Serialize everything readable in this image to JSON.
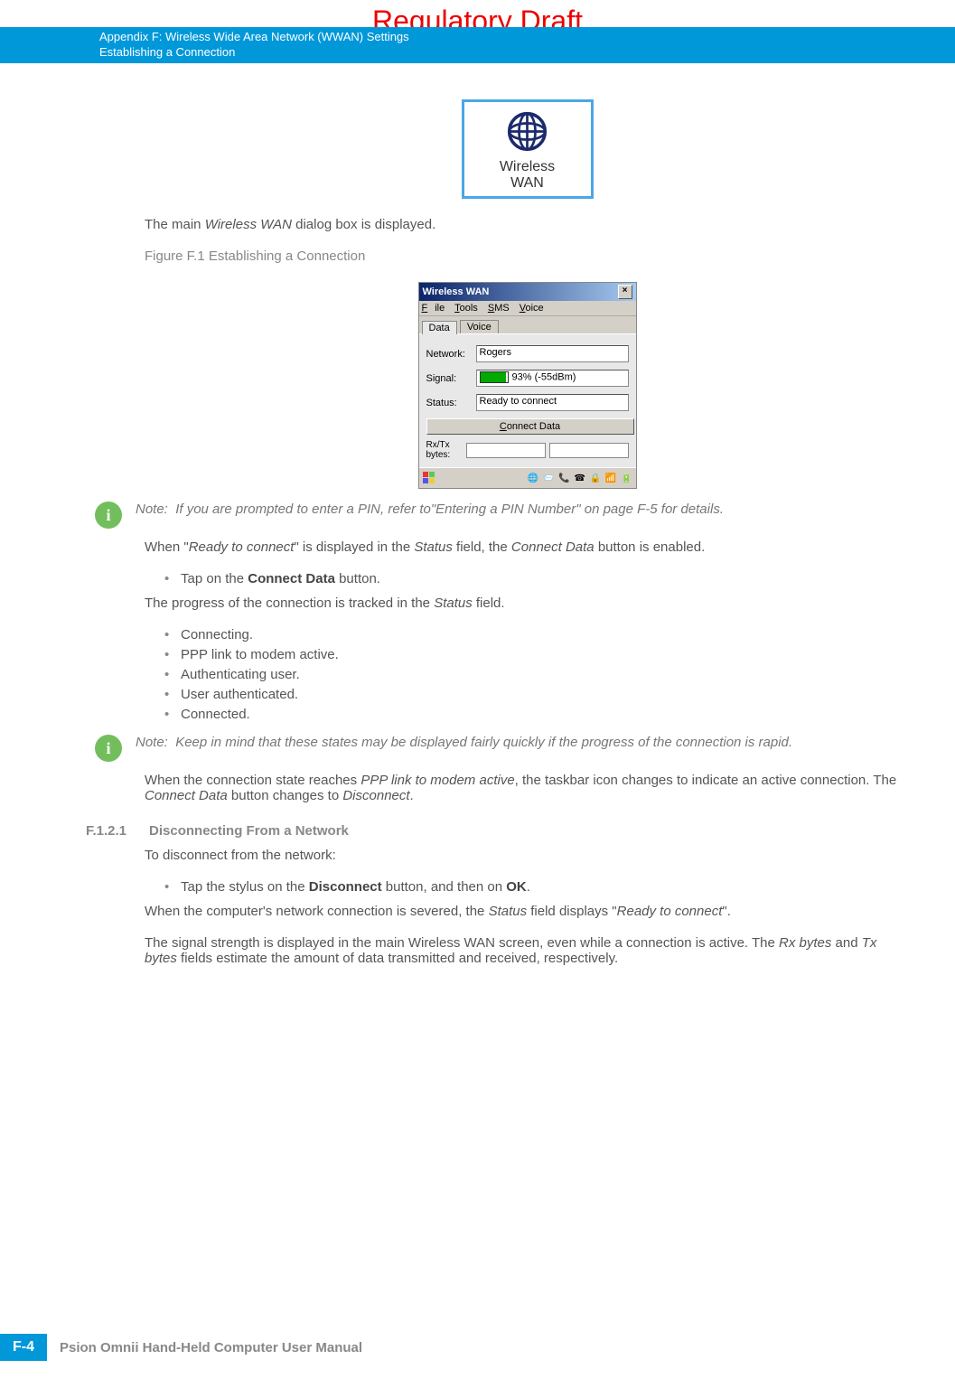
{
  "watermark": "Regulatory Draft",
  "header": {
    "line1": "Appendix F: Wireless Wide Area Network (WWAN) Settings",
    "line2": "Establishing a Connection"
  },
  "wwan_icon_label_line1": "Wireless",
  "wwan_icon_label_line2": "WAN",
  "para1_a": "The main ",
  "para1_em": "Wireless WAN",
  "para1_b": " dialog box is displayed.",
  "fig_caption": "Figure F.1      Establishing a Connection",
  "dialog": {
    "title": "Wireless WAN",
    "menu": {
      "file": "File",
      "tools": "Tools",
      "sms": "SMS",
      "voice": "Voice"
    },
    "tabs": {
      "data": "Data",
      "voice": "Voice"
    },
    "labels": {
      "network": "Network:",
      "signal": "Signal:",
      "status": "Status:",
      "rxtx": "Rx/Tx bytes:"
    },
    "values": {
      "network": "Rogers",
      "signal": "93% (-55dBm)",
      "status": "Ready to connect"
    },
    "connect_btn": "Connect Data"
  },
  "note1_prefix": "Note:",
  "note1_text": "If you are prompted to enter a PIN, refer to\"Entering a PIN Number\" on page F-5 for details.",
  "para2_a": "When \"",
  "para2_em1": "Ready to connect",
  "para2_b": "\" is displayed in the ",
  "para2_em2": "Status",
  "para2_c": " field, the ",
  "para2_em3": "Connect Data",
  "para2_d": " button is enabled.",
  "bullet_tap_a": "Tap on the ",
  "bullet_tap_b": "Connect Data",
  "bullet_tap_c": " button.",
  "para3_a": "The progress of the connection is tracked in the ",
  "para3_em": "Status",
  "para3_b": " field.",
  "status_list": [
    "Connecting.",
    "PPP link to modem active.",
    "Authenticating user.",
    "User authenticated.",
    "Connected."
  ],
  "note2_prefix": "Note:",
  "note2_text": "Keep in mind that these states may be displayed fairly quickly if the progress of the connection is rapid.",
  "para4_a": "When the connection state reaches ",
  "para4_em1": "PPP link to modem active",
  "para4_b": ", the taskbar icon changes to indicate an active connection. The ",
  "para4_em2": "Connect Data",
  "para4_c": " button changes to ",
  "para4_em3": "Disconnect",
  "para4_d": ".",
  "section_num": "F.1.2.1",
  "section_title": "Disconnecting From a Network",
  "para5": "To disconnect from the network:",
  "bullet_disc_a": "Tap the stylus on the ",
  "bullet_disc_b": "Disconnect",
  "bullet_disc_c": " button, and then on ",
  "bullet_disc_d": "OK",
  "bullet_disc_e": ".",
  "para6_a": "When the computer's network connection is severed, the ",
  "para6_em1": "Status",
  "para6_b": " field displays \"",
  "para6_em2": "Ready to connect",
  "para6_c": "\".",
  "para7_a": "The signal strength is displayed in the main Wireless WAN screen, even while a connection is active. The ",
  "para7_em1": "Rx bytes",
  "para7_b": " and ",
  "para7_em2": "Tx bytes",
  "para7_c": " fields estimate the amount of data transmitted and received, respectively.",
  "footer": {
    "page": "F-4",
    "manual": "Psion Omnii Hand-Held Computer User Manual"
  }
}
